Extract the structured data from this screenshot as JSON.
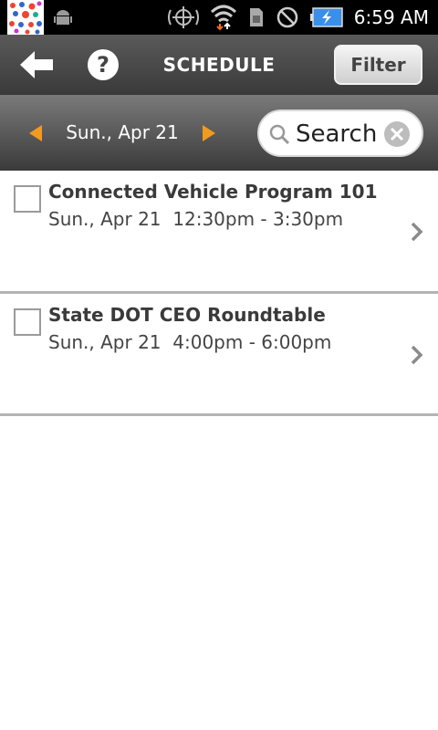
{
  "status_bar": {
    "time": "6:59 AM",
    "icons": [
      "app-thumbnail",
      "android-debug-icon",
      "gps-icon",
      "wifi-icon",
      "sim-icon",
      "blocked-icon",
      "battery-charging-icon"
    ]
  },
  "header": {
    "title": "SCHEDULE",
    "filter_label": "Filter",
    "back_icon": "back-arrow-icon",
    "help_icon": "help-icon"
  },
  "datebar": {
    "date": "Sun., Apr 21",
    "search_placeholder": "Search"
  },
  "sessions": [
    {
      "title": "Connected Vehicle Program 101",
      "date": "Sun., Apr 21",
      "time": "12:30pm - 3:30pm",
      "checked": false
    },
    {
      "title": "State DOT CEO Roundtable",
      "date": "Sun., Apr 21",
      "time": "4:00pm - 6:00pm",
      "checked": false
    }
  ],
  "colors": {
    "accent_arrow": "#f29a1e",
    "charging_blue": "#3a8fe8",
    "wifi_up": "#ffffff",
    "wifi_down": "#f26b1e"
  }
}
